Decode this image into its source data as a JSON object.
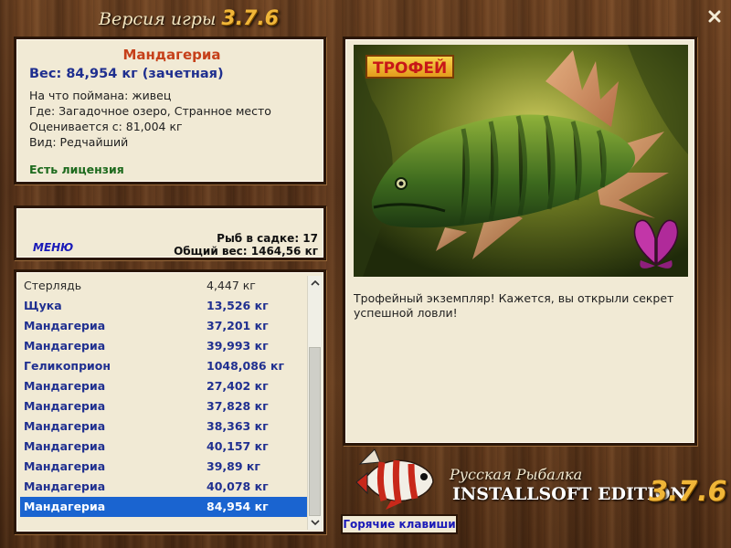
{
  "window": {
    "title_prefix": "Версия игры",
    "title_version": "3.7.6",
    "close_label": "x"
  },
  "info": {
    "fish_name": "Мандагериа",
    "weight": "Вес: 84,954 кг (зачетная)",
    "bait": "На что поймана: живец",
    "location": "Где: Загадочное озеро, Странное место",
    "value": "Оценивается с: 81,004 кг",
    "rarity": "Вид: Редчайший",
    "license": "Есть лицензия"
  },
  "menu": {
    "label": "МЕНЮ",
    "fish_count": "Рыб в садке: 17",
    "total_weight": "Общий вес: 1464,56 кг"
  },
  "catch_list": [
    {
      "name": "Стерлядь",
      "weight": "4,447 кг"
    },
    {
      "name": "Щука",
      "weight": "13,526 кг"
    },
    {
      "name": "Мандагериа",
      "weight": "37,201 кг"
    },
    {
      "name": "Мандагериа",
      "weight": "39,993 кг"
    },
    {
      "name": "Геликоприон",
      "weight": "1048,086 кг"
    },
    {
      "name": "Мандагериа",
      "weight": "27,402 кг"
    },
    {
      "name": "Мандагериа",
      "weight": "37,828 кг"
    },
    {
      "name": "Мандагериа",
      "weight": "38,363 кг"
    },
    {
      "name": "Мандагериа",
      "weight": "40,157 кг"
    },
    {
      "name": "Мандагериа",
      "weight": "39,89 кг"
    },
    {
      "name": "Мандагериа",
      "weight": "40,078 кг"
    },
    {
      "name": "Мандагериа",
      "weight": "84,954 кг"
    }
  ],
  "selected_index": 11,
  "trophy": {
    "badge": "ТРОФЕЙ",
    "description": "Трофейный экземпляр! Кажется, вы открыли секрет успешной ловли!"
  },
  "hotkeys_label": "Горячие клавиши",
  "logo": {
    "brand": "Русская Рыбалка",
    "edition": "INSTALLSOFT EDITION",
    "version": "3.7.6"
  },
  "icons": {
    "close": "close-icon",
    "scroll_up": "chevron-up-icon",
    "scroll_down": "chevron-down-icon",
    "butterfly": "butterfly-icon",
    "logo_fish": "fish-logo-icon"
  },
  "colors": {
    "wood": "#5a3518",
    "panel": "#f1ead5",
    "fish_name": "#c6401a",
    "accent_blue": "#1f2f8f",
    "license_green": "#1d6a1d",
    "selection": "#1a64d0",
    "version_gold": "#f0b638"
  }
}
